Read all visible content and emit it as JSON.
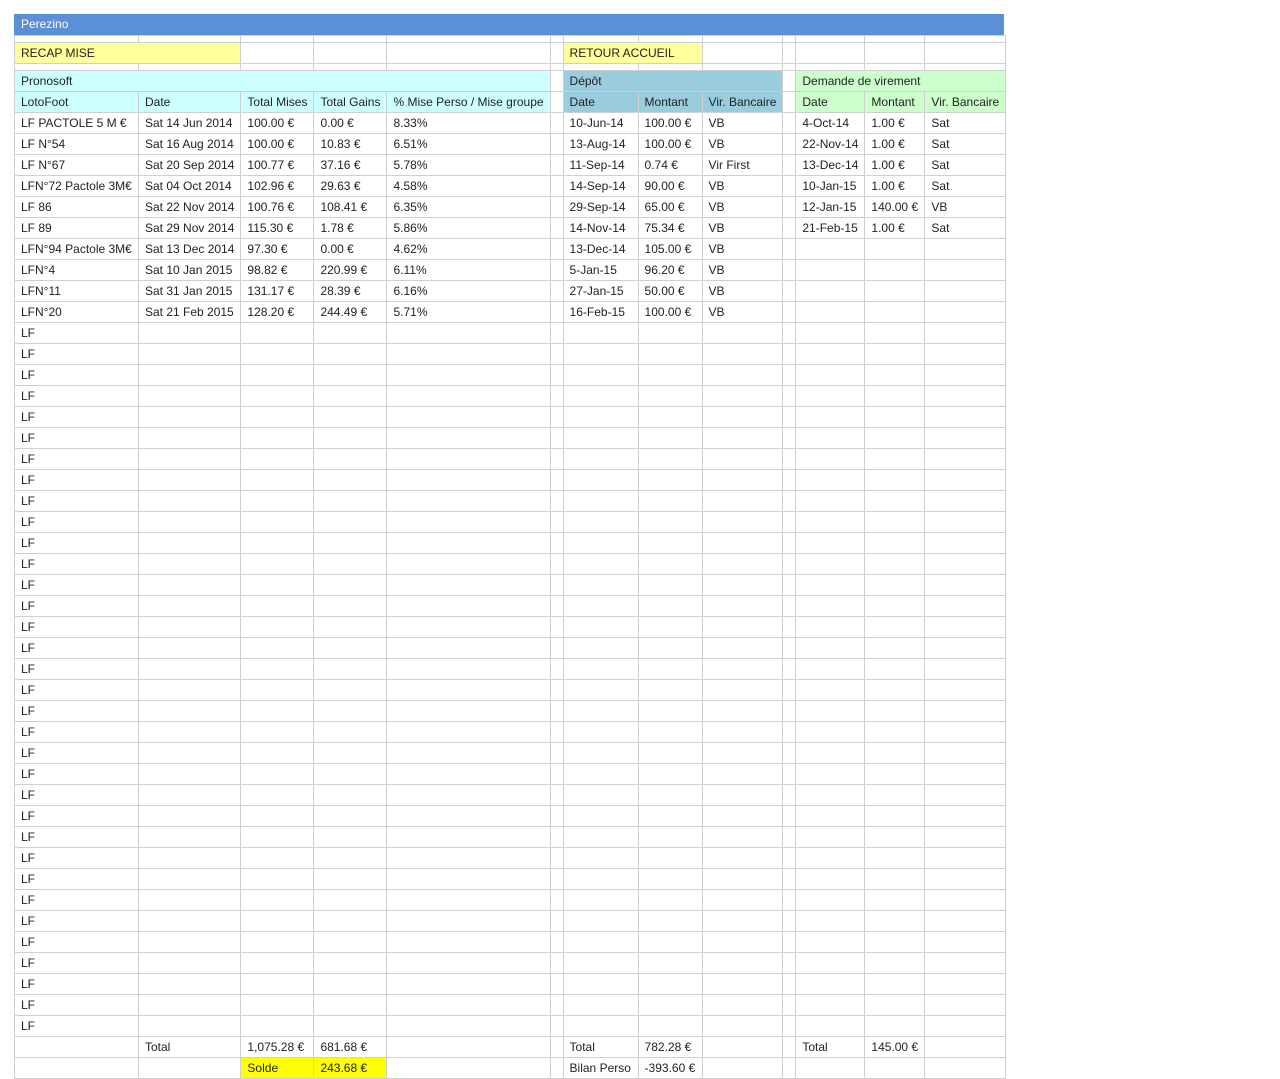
{
  "sheet": {
    "title": "Perezino"
  },
  "links": {
    "recap": "RECAP MISE",
    "retour": "RETOUR ACCUEIL"
  },
  "colors": {
    "title_bar": "#5b8fd6",
    "recap": "#ffff9c",
    "solde": "#ffff00",
    "pronosoft": "#ccffff",
    "depot": "#99cddd",
    "virement": "#ccffcc"
  },
  "pronosoft": {
    "title": "Pronosoft",
    "headers": [
      "LotoFoot",
      "Date",
      "Total Mises",
      "Total Gains",
      "% Mise Perso / Mise groupe"
    ],
    "rows": [
      [
        "LF PACTOLE 5 M €",
        "Sat 14 Jun 2014",
        "100.00 €",
        "0.00 €",
        "8.33%"
      ],
      [
        "LF N°54",
        "Sat 16 Aug 2014",
        "100.00 €",
        "10.83 €",
        "6.51%"
      ],
      [
        "LF N°67",
        "Sat 20 Sep 2014",
        "100.77 €",
        "37.16 €",
        "5.78%"
      ],
      [
        "LFN°72 Pactole 3M€",
        "Sat 04 Oct 2014",
        "102.96 €",
        "29.63 €",
        "4.58%"
      ],
      [
        "LF 86",
        "Sat 22 Nov 2014",
        "100.76 €",
        "108.41 €",
        "6.35%"
      ],
      [
        "LF 89",
        "Sat 29 Nov 2014",
        "115.30 €",
        "1.78 €",
        "5.86%"
      ],
      [
        "LFN°94 Pactole 3M€",
        "Sat 13 Dec 2014",
        "97.30 €",
        "0.00 €",
        "4.62%"
      ],
      [
        "LFN°4",
        "Sat 10 Jan 2015",
        "98.82 €",
        "220.99 €",
        "6.11%"
      ],
      [
        "LFN°11",
        "Sat 31 Jan 2015",
        "131.17 €",
        "28.39 €",
        "6.16%"
      ],
      [
        "LFN°20",
        "Sat 21 Feb 2015",
        "128.20 €",
        "244.49 €",
        "5.71%"
      ],
      [
        "LF"
      ],
      [
        "LF"
      ],
      [
        "LF"
      ],
      [
        "LF"
      ],
      [
        "LF"
      ],
      [
        "LF"
      ],
      [
        "LF"
      ],
      [
        "LF"
      ],
      [
        "LF"
      ],
      [
        "LF"
      ],
      [
        "LF"
      ],
      [
        "LF"
      ],
      [
        "LF"
      ],
      [
        "LF"
      ],
      [
        "LF"
      ],
      [
        "LF"
      ],
      [
        "LF"
      ],
      [
        "LF"
      ],
      [
        "LF"
      ],
      [
        "LF"
      ],
      [
        "LF"
      ],
      [
        "LF"
      ],
      [
        "LF"
      ],
      [
        "LF"
      ],
      [
        "LF"
      ],
      [
        "LF"
      ],
      [
        "LF"
      ],
      [
        "LF"
      ],
      [
        "LF"
      ],
      [
        "LF"
      ],
      [
        "LF"
      ],
      [
        "LF"
      ],
      [
        "LF"
      ],
      [
        "LF"
      ]
    ],
    "total_label": "Total",
    "total_mises": "1,075.28 €",
    "total_gains": "681.68 €",
    "solde_label": "Solde",
    "solde_value": "243.68 €"
  },
  "depot": {
    "title": "Dépôt",
    "headers": [
      "Date",
      "Montant",
      "Vir. Bancaire"
    ],
    "rows": [
      [
        "10-Jun-14",
        "100.00 €",
        "VB"
      ],
      [
        "13-Aug-14",
        "100.00 €",
        "VB"
      ],
      [
        "11-Sep-14",
        "0.74 €",
        "Vir First"
      ],
      [
        "14-Sep-14",
        "90.00 €",
        "VB"
      ],
      [
        "29-Sep-14",
        "65.00 €",
        "VB"
      ],
      [
        "14-Nov-14",
        "75.34 €",
        "VB"
      ],
      [
        "13-Dec-14",
        "105.00 €",
        "VB"
      ],
      [
        "5-Jan-15",
        "96.20 €",
        "VB"
      ],
      [
        "27-Jan-15",
        "50.00 €",
        "VB"
      ],
      [
        "16-Feb-15",
        "100.00 €",
        "VB"
      ]
    ],
    "total_label": "Total",
    "total_value": "782.28 €",
    "bilan_label": "Bilan Perso",
    "bilan_value": "-393.60 €"
  },
  "virement": {
    "title": "Demande de virement",
    "headers": [
      "Date",
      "Montant",
      "Vir. Bancaire"
    ],
    "rows": [
      [
        "4-Oct-14",
        "1.00 €",
        "Sat"
      ],
      [
        "22-Nov-14",
        "1.00 €",
        "Sat"
      ],
      [
        "13-Dec-14",
        "1.00 €",
        "Sat"
      ],
      [
        "10-Jan-15",
        "1.00 €",
        "Sat"
      ],
      [
        "12-Jan-15",
        "140.00 €",
        "VB"
      ],
      [
        "21-Feb-15",
        "1.00 €",
        "Sat"
      ]
    ],
    "total_label": "Total",
    "total_value": "145.00 €"
  }
}
